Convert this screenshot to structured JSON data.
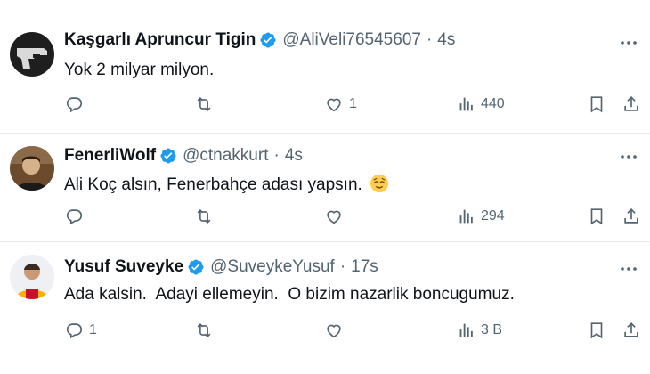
{
  "tweets": [
    {
      "name": "Kaşgarlı Apruncur Tigin",
      "handle": "@AliVeli76545607",
      "separator": "·",
      "time": "4s",
      "text": "Yok 2 milyar milyon.",
      "replies": "",
      "reposts": "",
      "likes": "1",
      "views": "440",
      "avatar_icon": "gun-avatar-icon"
    },
    {
      "name": "FenerliWolf",
      "handle": "@ctnakkurt",
      "separator": "·",
      "time": "4s",
      "text": "Ali Koç alsın, Fenerbahçe adası yapsın.",
      "emoji": "relieved-face-emoji",
      "replies": "",
      "reposts": "",
      "likes": "",
      "views": "294",
      "avatar_icon": "person-avatar-icon"
    },
    {
      "name": "Yusuf Suveyke",
      "handle": "@SuveykeYusuf",
      "separator": "·",
      "time": "17s",
      "text": "Ada kalsin.  Adayi ellemeyin.  O bizim nazarlik boncugumuz.",
      "replies": "1",
      "reposts": "",
      "likes": "",
      "views": "3 B",
      "avatar_icon": "fan-avatar-icon"
    }
  ],
  "colors": {
    "verified": "#1d9bf0",
    "secondary_text": "#536471",
    "primary_text": "#0f1419",
    "divider": "#e6e9ec"
  }
}
